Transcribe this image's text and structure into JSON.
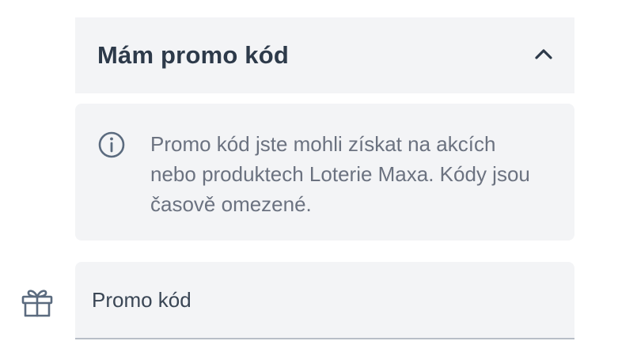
{
  "accordion": {
    "title": "Mám promo kód",
    "expanded": true
  },
  "info": {
    "icon": "info-icon",
    "text": "Promo kód jste mohli získat na akcích nebo produktech Loterie Maxa. Kódy jsou časově omezené."
  },
  "promo_field": {
    "icon": "gift-icon",
    "placeholder": "Promo kód",
    "value": ""
  },
  "colors": {
    "panel_bg": "#f3f4f6",
    "title_text": "#2d3a4a",
    "body_text": "#6b7280",
    "icon": "#5b6b7f",
    "input_underline": "#b8bec7"
  }
}
